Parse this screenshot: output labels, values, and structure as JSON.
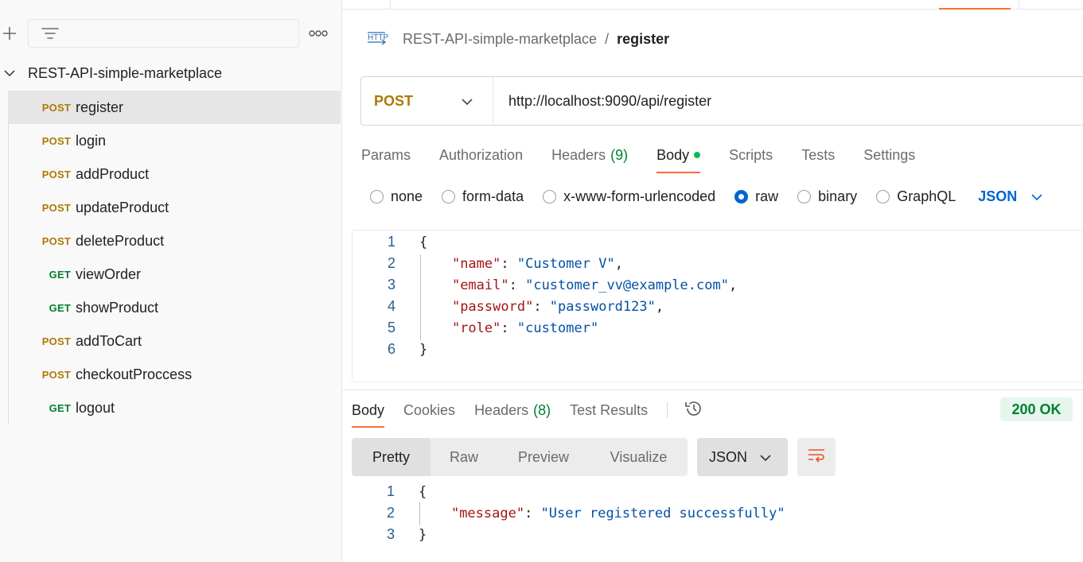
{
  "sidebar": {
    "collection_name": "REST-API-simple-marketplace",
    "requests": [
      {
        "method": "POST",
        "name": "register"
      },
      {
        "method": "POST",
        "name": "login"
      },
      {
        "method": "POST",
        "name": "addProduct"
      },
      {
        "method": "POST",
        "name": "updateProduct"
      },
      {
        "method": "POST",
        "name": "deleteProduct"
      },
      {
        "method": "GET",
        "name": "viewOrder"
      },
      {
        "method": "GET",
        "name": "showProduct"
      },
      {
        "method": "POST",
        "name": "addToCart"
      },
      {
        "method": "POST",
        "name": "checkoutProccess"
      },
      {
        "method": "GET",
        "name": "logout"
      }
    ]
  },
  "breadcrumb": {
    "collection": "REST-API-simple-marketplace",
    "separator": "/",
    "current": "register"
  },
  "request": {
    "method": "POST",
    "url": "http://localhost:9090/api/register",
    "tabs": [
      {
        "label": "Params"
      },
      {
        "label": "Authorization"
      },
      {
        "label": "Headers",
        "count": "(9)"
      },
      {
        "label": "Body"
      },
      {
        "label": "Scripts"
      },
      {
        "label": "Tests"
      },
      {
        "label": "Settings"
      }
    ],
    "body_types": [
      "none",
      "form-data",
      "x-www-form-urlencoded",
      "raw",
      "binary",
      "GraphQL"
    ],
    "selected_body_type": "raw",
    "format": "JSON",
    "body_lines": [
      {
        "n": "1",
        "text": "{"
      },
      {
        "n": "2",
        "key": "\"name\"",
        "value": "\"Customer V\"",
        "trail": ","
      },
      {
        "n": "3",
        "key": "\"email\"",
        "value": "\"customer_vv@example.com\"",
        "trail": ","
      },
      {
        "n": "4",
        "key": "\"password\"",
        "value": "\"password123\"",
        "trail": ","
      },
      {
        "n": "5",
        "key": "\"role\"",
        "value": "\"customer\"",
        "trail": ""
      },
      {
        "n": "6",
        "text": "}"
      }
    ]
  },
  "response": {
    "tabs": [
      {
        "label": "Body"
      },
      {
        "label": "Cookies"
      },
      {
        "label": "Headers",
        "count": "(8)"
      },
      {
        "label": "Test Results"
      }
    ],
    "status": "200 OK",
    "view_modes": [
      "Pretty",
      "Raw",
      "Preview",
      "Visualize"
    ],
    "format": "JSON",
    "body_lines": [
      {
        "n": "1",
        "text": "{"
      },
      {
        "n": "2",
        "key": "\"message\"",
        "value": "\"User registered successfully\"",
        "trail": ""
      },
      {
        "n": "3",
        "text": "}"
      }
    ]
  },
  "colors": {
    "post": "#ad7a03",
    "get": "#007f31",
    "accent": "#ff6c37",
    "link": "#0265d2"
  }
}
